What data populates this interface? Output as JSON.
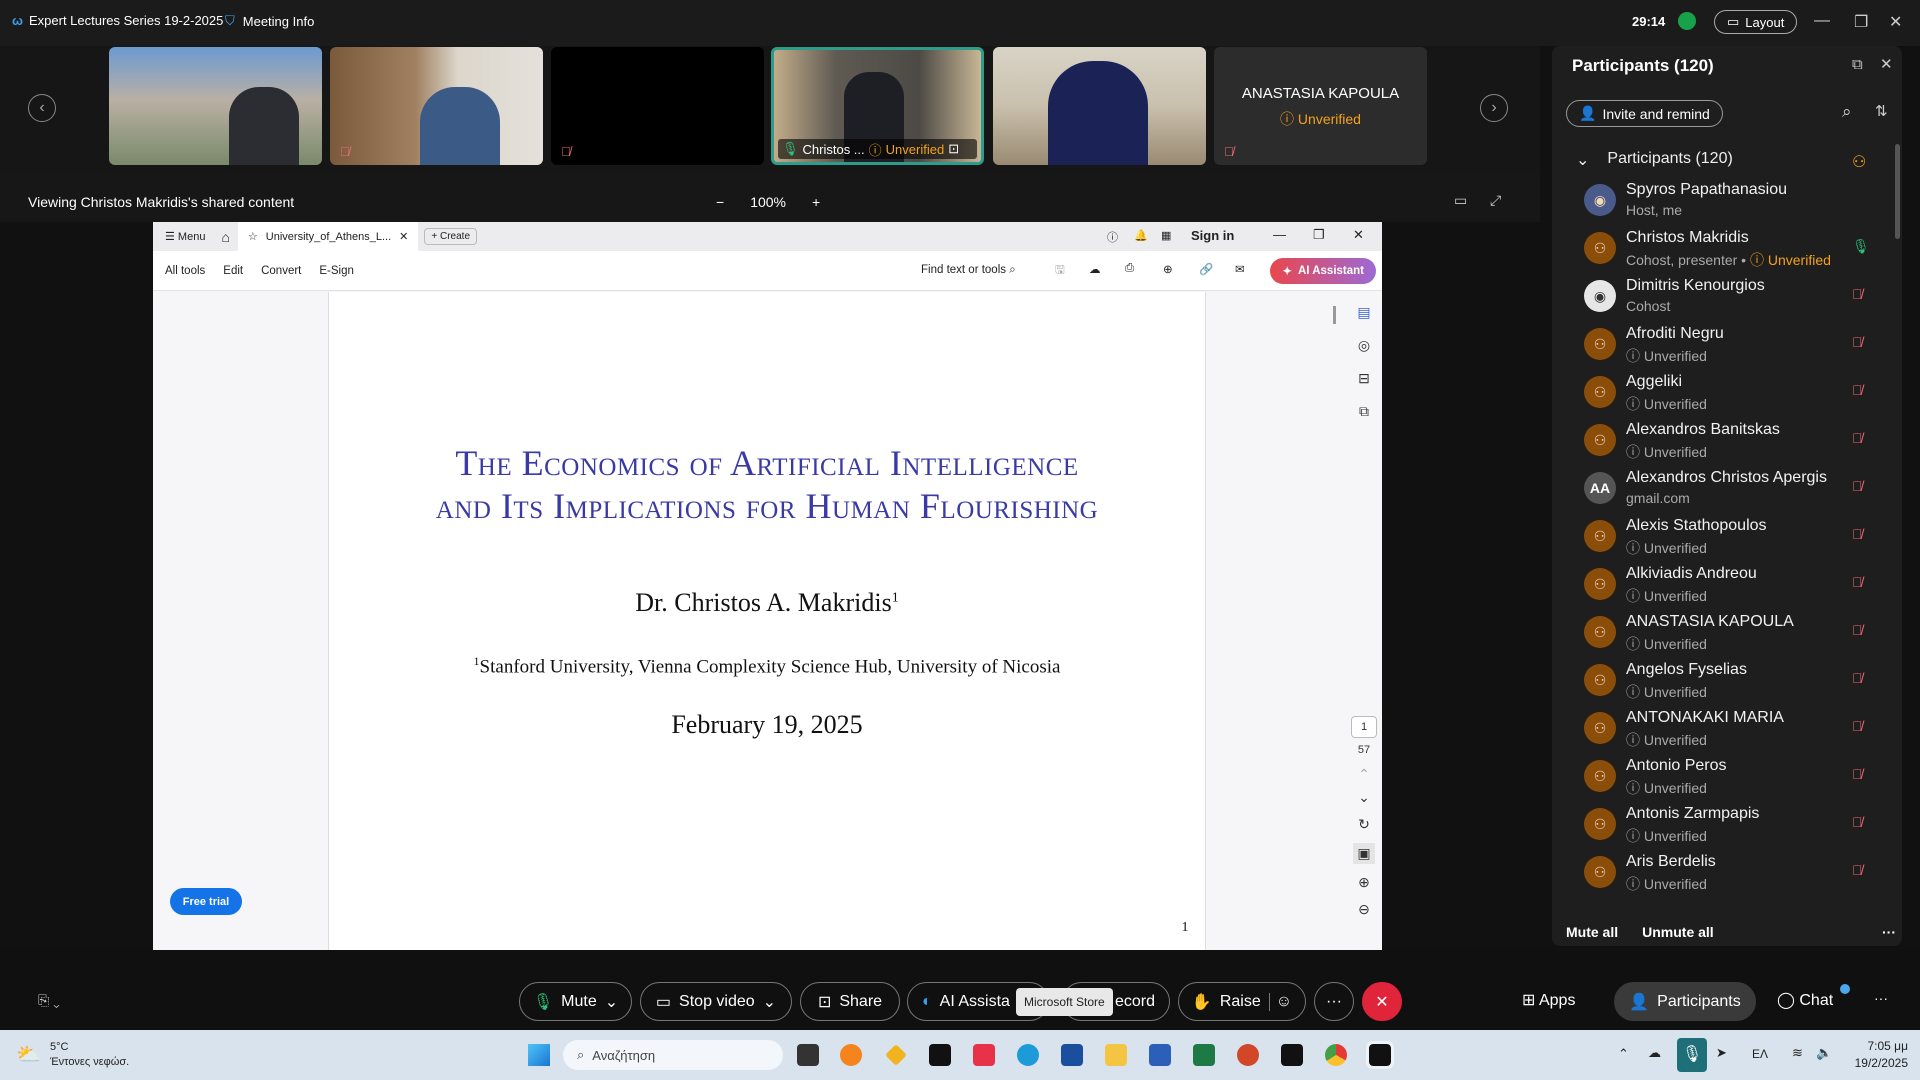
{
  "titlebar": {
    "app_title": "Expert Lectures Series 19-2-2025",
    "meeting_info": "Meeting Info",
    "timer": "29:14",
    "layout_label": "Layout"
  },
  "video_strip": {
    "tiles": [
      {
        "name": "",
        "muted": false
      },
      {
        "name": "",
        "muted": true
      },
      {
        "name": "",
        "muted": true
      },
      {
        "name": "Christos ...",
        "status": "Unverified",
        "active": true
      },
      {
        "name": "",
        "muted": false
      },
      {
        "name": "ANASTASIA KAPOULA",
        "status": "Unverified",
        "muted": true
      }
    ]
  },
  "share_header": {
    "text": "Viewing Christos Makridis's shared content",
    "zoom_minus": "−",
    "zoom_level": "100%",
    "zoom_plus": "+"
  },
  "acrobat": {
    "menu": "Menu",
    "tab_title": "University_of_Athens_L...",
    "create": "Create",
    "sign_in": "Sign in",
    "tools": [
      "All tools",
      "Edit",
      "Convert",
      "E-Sign"
    ],
    "find_placeholder": "Find text or tools",
    "ai_assistant": "AI Assistant",
    "free_trial": "Free trial",
    "page_current": "1",
    "page_total": "57",
    "document": {
      "title_line1": "The Economics of Artificial Intelligence",
      "title_line2": "and Its Implications for Human Flourishing",
      "author": "Dr. Christos A. Makridis",
      "author_sup": "1",
      "affiliation_sup": "1",
      "affiliation": "Stanford University, Vienna Complexity Science Hub, University of Nicosia",
      "date": "February 19, 2025",
      "page_number": "1"
    }
  },
  "participants": {
    "title": "Participants (120)",
    "invite": "Invite and remind",
    "group_label": "Participants (120)",
    "list": [
      {
        "name": "Spyros Papathanasiou",
        "status": "Host, me",
        "avatar": "photo",
        "mic": ""
      },
      {
        "name": "Christos Makridis",
        "status": "Cohost, presenter",
        "status2": "Unverified",
        "avatar": "generic",
        "mic": "on"
      },
      {
        "name": "Dimitris Kenourgios",
        "status": "Cohost",
        "avatar": "photo",
        "mic": "muted"
      },
      {
        "name": "Afroditi Negru",
        "status": "Unverified",
        "avatar": "generic",
        "mic": "muted"
      },
      {
        "name": "Aggeliki",
        "status": "Unverified",
        "avatar": "generic",
        "mic": "muted"
      },
      {
        "name": "Alexandros Banitskas",
        "status": "Unverified",
        "avatar": "generic",
        "mic": "muted"
      },
      {
        "name": "Alexandros Christos Apergis",
        "status": "gmail.com",
        "avatar": "AA",
        "mic": "muted"
      },
      {
        "name": "Alexis Stathopoulos",
        "status": "Unverified",
        "avatar": "generic",
        "mic": "muted"
      },
      {
        "name": "Alkiviadis Andreou",
        "status": "Unverified",
        "avatar": "generic",
        "mic": "muted"
      },
      {
        "name": "ANASTASIA KAPOULA",
        "status": "Unverified",
        "avatar": "generic",
        "mic": "muted"
      },
      {
        "name": "Angelos Fyselias",
        "status": "Unverified",
        "avatar": "generic",
        "mic": "muted"
      },
      {
        "name": "ANTONAKAKI MARIA",
        "status": "Unverified",
        "avatar": "generic",
        "mic": "muted"
      },
      {
        "name": "Antonio Peros",
        "status": "Unverified",
        "avatar": "generic",
        "mic": "muted"
      },
      {
        "name": "Antonis Zarmpapis",
        "status": "Unverified",
        "avatar": "generic",
        "mic": "muted"
      },
      {
        "name": "Aris Berdelis",
        "status": "Unverified",
        "avatar": "generic",
        "mic": "muted"
      }
    ],
    "mute_all": "Mute all",
    "unmute_all": "Unmute all"
  },
  "controls": {
    "mute": "Mute",
    "stop_video": "Stop video",
    "share": "Share",
    "ai_assistant": "AI Assista",
    "record": "ecord",
    "raise": "Raise",
    "more": "···",
    "apps": "Apps",
    "participants": "Participants",
    "chat": "Chat",
    "tooltip": "Microsoft Store"
  },
  "taskbar": {
    "temp": "5°C",
    "weather": "Έντονες νεφώσ.",
    "search_placeholder": "Αναζήτηση",
    "lang": "ΕΛ",
    "time": "7:05 μμ",
    "date": "19/2/2025"
  },
  "colors": {
    "accent_teal": "#2e9c8b",
    "unverified": "#f3a21b",
    "muted": "#f06a7a",
    "end_red": "#e0243a",
    "doc_title": "#3a3aa6"
  }
}
